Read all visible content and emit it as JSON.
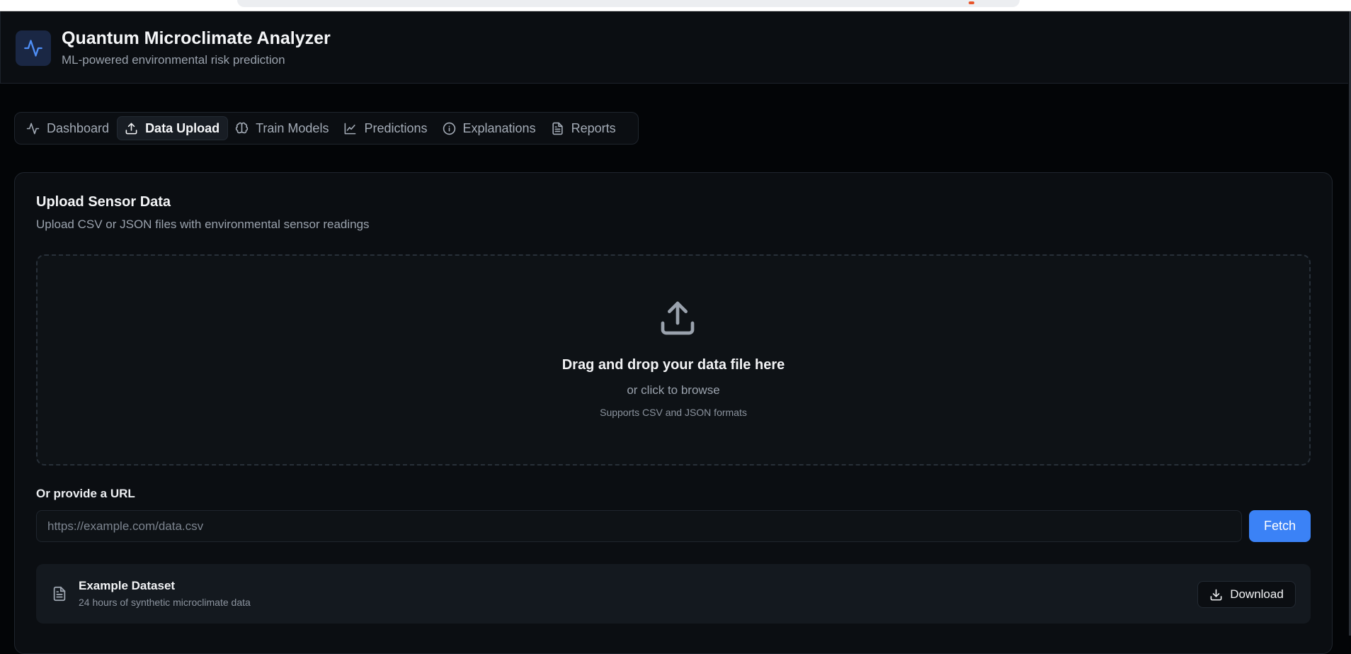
{
  "colors": {
    "accent": "#3b82f6",
    "background": "#030507",
    "surface": "#0b0e12"
  },
  "header": {
    "logo_icon": "activity-icon",
    "title": "Quantum Microclimate Analyzer",
    "subtitle": "ML-powered environmental risk prediction"
  },
  "tabs": [
    {
      "label": "Dashboard",
      "icon": "activity-icon",
      "active": false
    },
    {
      "label": "Data Upload",
      "icon": "upload-icon",
      "active": true
    },
    {
      "label": "Train Models",
      "icon": "brain-icon",
      "active": false
    },
    {
      "label": "Predictions",
      "icon": "line-chart-icon",
      "active": false
    },
    {
      "label": "Explanations",
      "icon": "info-icon",
      "active": false
    },
    {
      "label": "Reports",
      "icon": "file-text-icon",
      "active": false
    }
  ],
  "upload_card": {
    "title": "Upload Sensor Data",
    "description": "Upload CSV or JSON files with environmental sensor readings",
    "dropzone": {
      "icon": "upload-icon",
      "main_text": "Drag and drop your data file here",
      "sub_text": "or click to browse",
      "hint": "Supports CSV and JSON formats"
    },
    "url": {
      "label": "Or provide a URL",
      "placeholder": "https://example.com/data.csv",
      "value": "",
      "fetch_label": "Fetch"
    },
    "example": {
      "icon": "file-text-icon",
      "title": "Example Dataset",
      "description": "24 hours of synthetic microclimate data",
      "download_icon": "download-icon",
      "download_label": "Download"
    }
  }
}
